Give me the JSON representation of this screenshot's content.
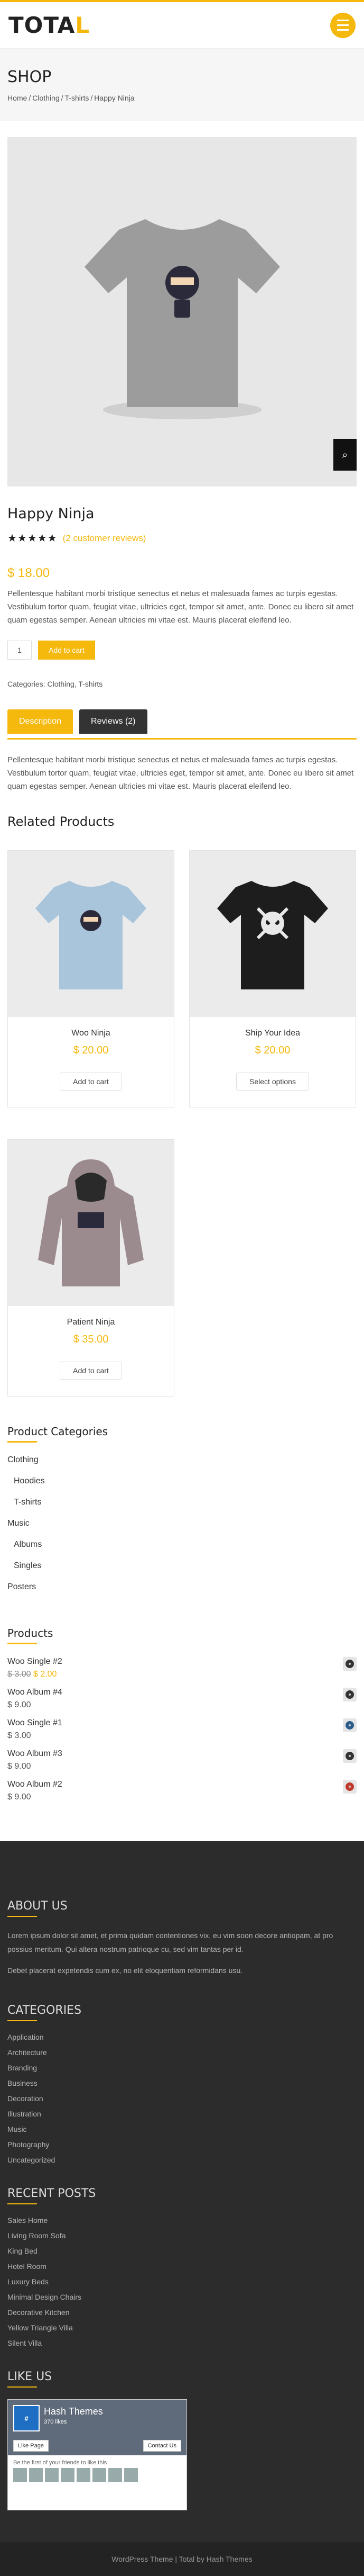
{
  "site": {
    "logo_main": "TOTA",
    "logo_accent": "L",
    "menu_icon": "hamburger-icon"
  },
  "page": {
    "title": "SHOP",
    "breadcrumb": [
      "Home",
      "Clothing",
      "T-shirts",
      "Happy Ninja"
    ]
  },
  "product": {
    "title": "Happy Ninja",
    "stars": "★★★★★",
    "rating": 4,
    "reviews_link": "(2 customer reviews)",
    "price": "$ 18.00",
    "short_desc": "Pellentesque habitant morbi tristique senectus et netus et malesuada fames ac turpis egestas. Vestibulum tortor quam, feugiat vitae, ultricies eget, tempor sit amet, ante. Donec eu libero sit amet quam egestas semper. Aenean ultricies mi vitae est. Mauris placerat eleifend leo.",
    "qty": "1",
    "add_to_cart": "Add to cart",
    "categories": "Categories: Clothing, T-shirts",
    "tabs": [
      "Description",
      "Reviews (2)"
    ],
    "tab_desc": "Pellentesque habitant morbi tristique senectus et netus et malesuada fames ac turpis egestas. Vestibulum tortor quam, feugiat vitae, ultricies eget, tempor sit amet, ante. Donec eu libero sit amet quam egestas semper. Aenean ultricies mi vitae est. Mauris placerat eleifend leo."
  },
  "related": {
    "title": "Related Products",
    "items": [
      {
        "name": "Woo Ninja",
        "price": "$ 20.00",
        "button": "Add to cart",
        "color": "#a9c5dc"
      },
      {
        "name": "Ship Your Idea",
        "price": "$ 20.00",
        "button": "Select options",
        "color": "#1d1d1d"
      },
      {
        "name": "Patient Ninja",
        "price": "$ 35.00",
        "button": "Add to cart",
        "color": "#9b8a8e"
      }
    ]
  },
  "product_categories": {
    "title": "Product Categories",
    "items": [
      {
        "label": "Clothing",
        "sub": false
      },
      {
        "label": "Hoodies",
        "sub": true
      },
      {
        "label": "T-shirts",
        "sub": true
      },
      {
        "label": "Music",
        "sub": false
      },
      {
        "label": "Albums",
        "sub": true
      },
      {
        "label": "Singles",
        "sub": true
      },
      {
        "label": "Posters",
        "sub": false
      }
    ]
  },
  "products_widget": {
    "title": "Products",
    "items": [
      {
        "name": "Woo Single #2",
        "old": "$ 3.00",
        "price": "$ 2.00"
      },
      {
        "name": "Woo Album #4",
        "old": "",
        "price": "$ 9.00"
      },
      {
        "name": "Woo Single #1",
        "old": "",
        "price": "$ 3.00"
      },
      {
        "name": "Woo Album #3",
        "old": "",
        "price": "$ 9.00"
      },
      {
        "name": "Woo Album #2",
        "old": "",
        "price": "$ 9.00"
      }
    ]
  },
  "footer": {
    "about_title": "ABOUT US",
    "about_p1": "Lorem ipsum dolor sit amet, et prima quidam contentiones vix, eu vim soon decore antiopam, at pro possius meritum. Qui altera nostrum patrioque cu, sed vim tantas per id.",
    "about_p2": "Debet placerat expetendis cum ex, no elit eloquentiam reformidans usu.",
    "categories_title": "CATEGORIES",
    "categories": [
      "Application",
      "Architecture",
      "Branding",
      "Business",
      "Decoration",
      "Illustration",
      "Music",
      "Photography",
      "Uncategorized"
    ],
    "recent_title": "RECENT POSTS",
    "recent": [
      "Sales Home",
      "Living Room Sofa",
      "King Bed",
      "Hotel Room",
      "Luxury Beds",
      "Minimal Design Chairs",
      "Decorative Kitchen",
      "Yellow Triangle Villa",
      "Silent Villa"
    ],
    "like_title": "LIKE US",
    "fb_name": "Hash Themes",
    "fb_likes": "370 likes",
    "fb_like_btn": "Like Page",
    "fb_contact": "Contact Us",
    "fb_friends": "Be the first of your friends to like this",
    "copyright": "WordPress Theme | Total by Hash Themes"
  }
}
